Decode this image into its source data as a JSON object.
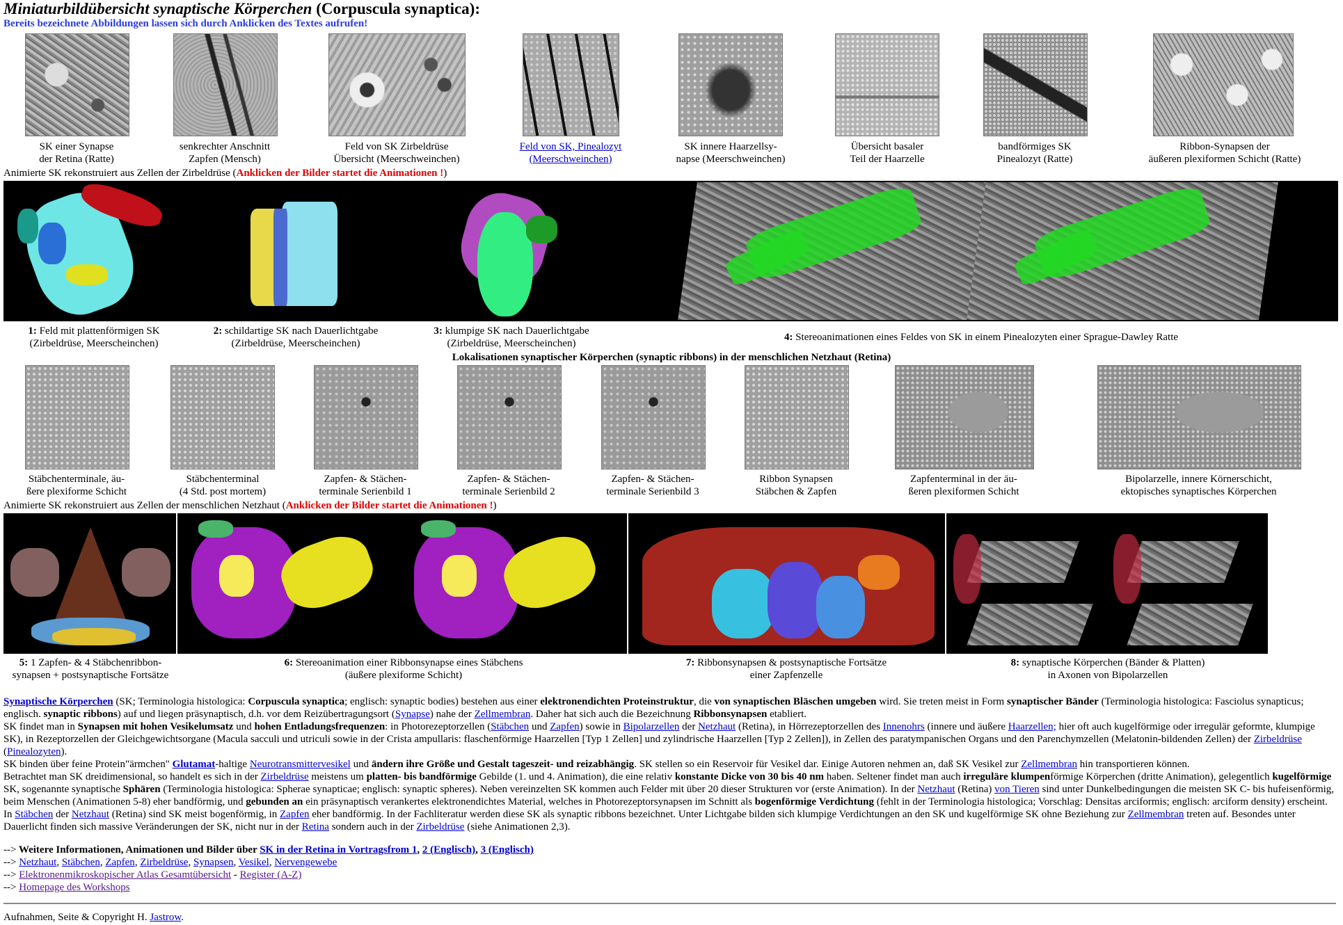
{
  "title_italic": "Miniaturbildübersicht synaptische Körperchen",
  "title_rest": " (Corpuscula synaptica):",
  "subnote": "Bereits bezeichnete Abbildungen lassen sich durch Anklicken des Textes aufrufen!",
  "row1": [
    {
      "l1": "SK einer Synapse",
      "l2": "der Retina (Ratte)"
    },
    {
      "l1": "senkrechter Anschnitt",
      "l2": "Zapfen (Mensch)"
    },
    {
      "l1": "Feld von SK Zirbeldrüse",
      "l2": "Übersicht (Meerschweinchen)"
    },
    {
      "l1": "Feld von SK, Pinealozyt",
      "l2": "(Meerschweinchen)"
    },
    {
      "l1": "SK innere Haarzellsy-",
      "l2": "napse (Meerschweinchen)"
    },
    {
      "l1": "Übersicht basaler",
      "l2": "Teil der Haarzelle"
    },
    {
      "l1": "bandförmiges SK",
      "l2": "Pinealozyt (Ratte)"
    },
    {
      "l1": "Ribbon-Synapsen der",
      "l2": "äußeren plexiformen Schicht (Ratte)"
    }
  ],
  "anim_heading1_a": "Animierte SK rekonstruiert aus Zellen der Zirbeldrüse (",
  "anim_heading1_red": "Anklicken der Bilder startet die Animationen !",
  "anim_heading1_b": ")",
  "anim1": [
    {
      "num": "1:",
      "l1": " Feld mit plattenförmigen SK",
      "l2": "(Zirbeldrüse, Meerscheinchen)"
    },
    {
      "num": "2:",
      "l1": " schildartige SK nach Dauerlichtgabe",
      "l2": "(Zirbeldrüse, Meerscheinchen)"
    },
    {
      "num": "3:",
      "l1": " klumpige SK nach Dauerlichtgabe",
      "l2": "(Zirbeldrüse, Meerscheinchen)"
    },
    {
      "num": "4:",
      "l1": " Stereoanimationen eines Feldes von SK in einem Pinealozyten einer Sprague-Dawley Ratte",
      "l2": ""
    }
  ],
  "retina_heading": "Lokalisationen synaptischer Körperchen (synaptic ribbons) in der menschlichen Netzhaut (Retina)",
  "row2": [
    {
      "l1": "Stäbchenterminale, äu-",
      "l2": "ßere plexiforme Schicht"
    },
    {
      "l1": "Stäbchenterminal",
      "l2": "(4 Std. post mortem)"
    },
    {
      "l1": "Zapfen- & Stächen-",
      "l2": "terminale Serienbild 1"
    },
    {
      "l1": "Zapfen- & Stächen-",
      "l2": "terminale Serienbild 2"
    },
    {
      "l1": "Zapfen- & Stächen-",
      "l2": "terminale Serienbild 3"
    },
    {
      "l1": "Ribbon Synapsen",
      "l2": "Stäbchen & Zapfen"
    },
    {
      "l1": "Zapfenterminal in der äu-",
      "l2": "ßeren plexiformen Schicht"
    },
    {
      "l1": "Bipolarzelle, innere Körnerschicht,",
      "l2": "ektopisches synaptisches Körperchen"
    }
  ],
  "anim_heading2_a": "Animierte SK rekonstruiert aus Zellen der menschlichen Netzhaut (",
  "anim_heading2_red": "Anklicken der Bilder startet die Animationen !",
  "anim_heading2_b": ")",
  "anim2": [
    {
      "num": "5:",
      "l1": " 1 Zapfen- & 4 Stäbchenribbon-",
      "l2": "synapsen + postsynaptische Fortsätze"
    },
    {
      "num": "6:",
      "l1": " Stereoanimation einer Ribbonsynapse eines Stäbchens",
      "l2": "(äußere plexiforme Schicht)"
    },
    {
      "num": "7:",
      "l1": " Ribbonsynapsen & postsynaptische Fortsätze",
      "l2": "einer Zapfenzelle"
    },
    {
      "num": "8:",
      "l1": " synaptische Körperchen (Bänder & Platten)",
      "l2": "in Axonen von Bipolarzellen"
    }
  ],
  "body": {
    "p1_link": "Synaptische Körperchen",
    "p1": " (SK; Terminologia histologica: ",
    "p1_b1": "Corpuscula synaptica",
    "p1_c": "; englisch: synaptic bodies) bestehen aus einer ",
    "p1_b2": "elektronendichten Proteinstruktur",
    "p1_d": ", die ",
    "p1_b3": "von synaptischen Bläschen umgeben",
    "p1_e": " wird. Sie treten meist in Form ",
    "p1_b4": "synaptischer Bänder",
    "p1_f": " (Terminologia histologica: Fasciolus synapticus; englisch. ",
    "p1_b5": "synaptic ribbons",
    "p1_g": ") auf und liegen präsynaptisch, d.h. vor dem Reizübertragungsort (",
    "p1_l2": "Synapse",
    "p1_h": ") nahe der ",
    "p1_l3": "Zellmembran",
    "p1_i": ". Daher hat sich auch die Bezeichnung ",
    "p1_b6": "Ribbonsynapsen",
    "p1_j": " etabliert.",
    "p2_a": "SK findet man in  ",
    "p2_b1": "Synapsen mit hohen Vesikelumsatz",
    "p2_b": " und ",
    "p2_b2": "hohen Entladungsfrequenzen",
    "p2_c": ": in Photorezeptorzellen (",
    "p2_l1": "Stäbchen",
    "p2_d": " und ",
    "p2_l2": "Zapfen",
    "p2_e": ") sowie in ",
    "p2_l3": "Bipolarzellen",
    "p2_f": " der ",
    "p2_l4": "Netzhaut",
    "p2_g": " (Retina), in Hörrezeptorzellen des ",
    "p2_l5": "Innenohrs",
    "p2_h": " (innere und äußere ",
    "p2_l6": "Haarzellen;",
    "p2_i": " hier oft auch kugelförmige oder irregulär geformte, klumpige SK), in  Rezeptorzellen der Gleichgewichtsorgane (Macula sacculi und utriculi sowie in der Crista ampullaris: flaschenförmige Haarzellen [Typ 1 Zellen] und zylindrische Haarzellen [Typ 2 Zellen]), in Zellen des paratympanischen Organs und den Parenchymzellen (Melatonin-bildenden Zellen) der ",
    "p2_l7": "Zirbeldrüse",
    "p2_j": " (",
    "p2_l8": "Pinealozyten",
    "p2_k": ").",
    "p3_a": "SK binden über feine Protein\"ärmchen\" ",
    "p3_l1": "Glutamat",
    "p3_b": "-haltige ",
    "p3_l2": "Neurotransmittervesikel",
    "p3_c": " und ",
    "p3_b1": "ändern ihre Größe und Gestalt tageszeit- und reizabhängig",
    "p3_d": ". SK stellen so ein Reservoir für Vesikel dar. Einige Autoren nehmen an, daß SK Vesikel zur ",
    "p3_l3": "Zellmembran",
    "p3_e": " hin transportieren können.",
    "p4_a": "Betrachtet man SK dreidimensional, so handelt es sich in der ",
    "p4_l1": "Zirbeldrüse",
    "p4_b": " meistens um ",
    "p4_b1": "platten- bis bandförmige",
    "p4_c": " Gebilde (1. und 4. Animation), die eine relativ ",
    "p4_b2": "konstante Dicke von 30 bis 40 nm",
    "p4_d": " haben. Seltener findet man auch ",
    "p4_b3": "irreguläre klumpen",
    "p4_e": "förmige Körperchen (dritte Animation), gelegentlich ",
    "p4_b4": "kugelförmige",
    "p4_f": " SK, sogenannte synaptische ",
    "p4_b5": "Sphären",
    "p4_g": " (Terminologia histologica: Spherae synapticae; englisch: synaptic spheres). Neben vereinzelten SK kommen auch Felder mit über 20 dieser Strukturen vor (erste Animation). In der ",
    "p4_l2": "Netzhaut",
    "p4_h": " (Retina) ",
    "p4_l3": "von Tieren",
    "p4_i": " sind unter Dunkelbedingungen die meisten SK C- bis hufeisenförmig, beim Menschen (Animationen 5-8) eher bandförmig, und ",
    "p4_b6": "gebunden an",
    "p4_j": " ein präsynaptisch verankertes elektronendichtes Material, welches in Photorezeptorsynapsen im Schnitt als ",
    "p4_b7": "bogenförmige Verdichtung",
    "p4_k": " (fehlt in der Terminologia histologica; Vorschlag: Densitas arciformis; englisch: arciform density) erscheint. In ",
    "p4_l4": "Stäbchen",
    "p4_l": " der ",
    "p4_l5": "Netzhaut",
    "p4_m": " (Retina) sind SK meist bogenförmig, in ",
    "p4_l6": "Zapfen",
    "p4_n": " eher bandförmig. In der Fachliteratur werden diese SK als synaptic ribbons bezeichnet. Unter Lichtgabe bilden sich klumpige Verdichtungen an den SK und kugelförmige SK ohne Beziehung zur ",
    "p4_l7": "Zellmembran",
    "p4_o": " treten auf. Besondes unter Dauerlicht finden sich massive Veränderungen der SK, nicht nur in der ",
    "p4_l8": "Retina",
    "p4_p": " sondern auch in der ",
    "p4_l9": "Zirbeldrüse",
    "p4_q": " (siehe Animationen 2,3)."
  },
  "nav": {
    "arrow": "-->",
    "n1_b": " Weitere Informationen, Animationen und Bilder über ",
    "n1_l1": "SK in der Retina in Vortragsfrom 1",
    "n1_sep1": ", ",
    "n1_l2": "2 (Englisch)",
    "n1_sep2": ", ",
    "n1_l3": "3 (Englisch)",
    "n2_links": [
      "Netzhaut",
      "Stäbchen",
      "Zapfen",
      "Zirbeldrüse",
      "Synapsen",
      "Vesikel",
      "Nervengewebe"
    ],
    "n3_l1": "Elektronenmikroskopischer Atlas Gesamtübersicht",
    "n3_sep": " - ",
    "n3_l2": "Register (A-Z)",
    "n4_l1": "Homepage des Workshops "
  },
  "footer_a": "Aufnahmen, Seite & Copyright H. ",
  "footer_link": "Jastrow",
  "footer_b": "."
}
